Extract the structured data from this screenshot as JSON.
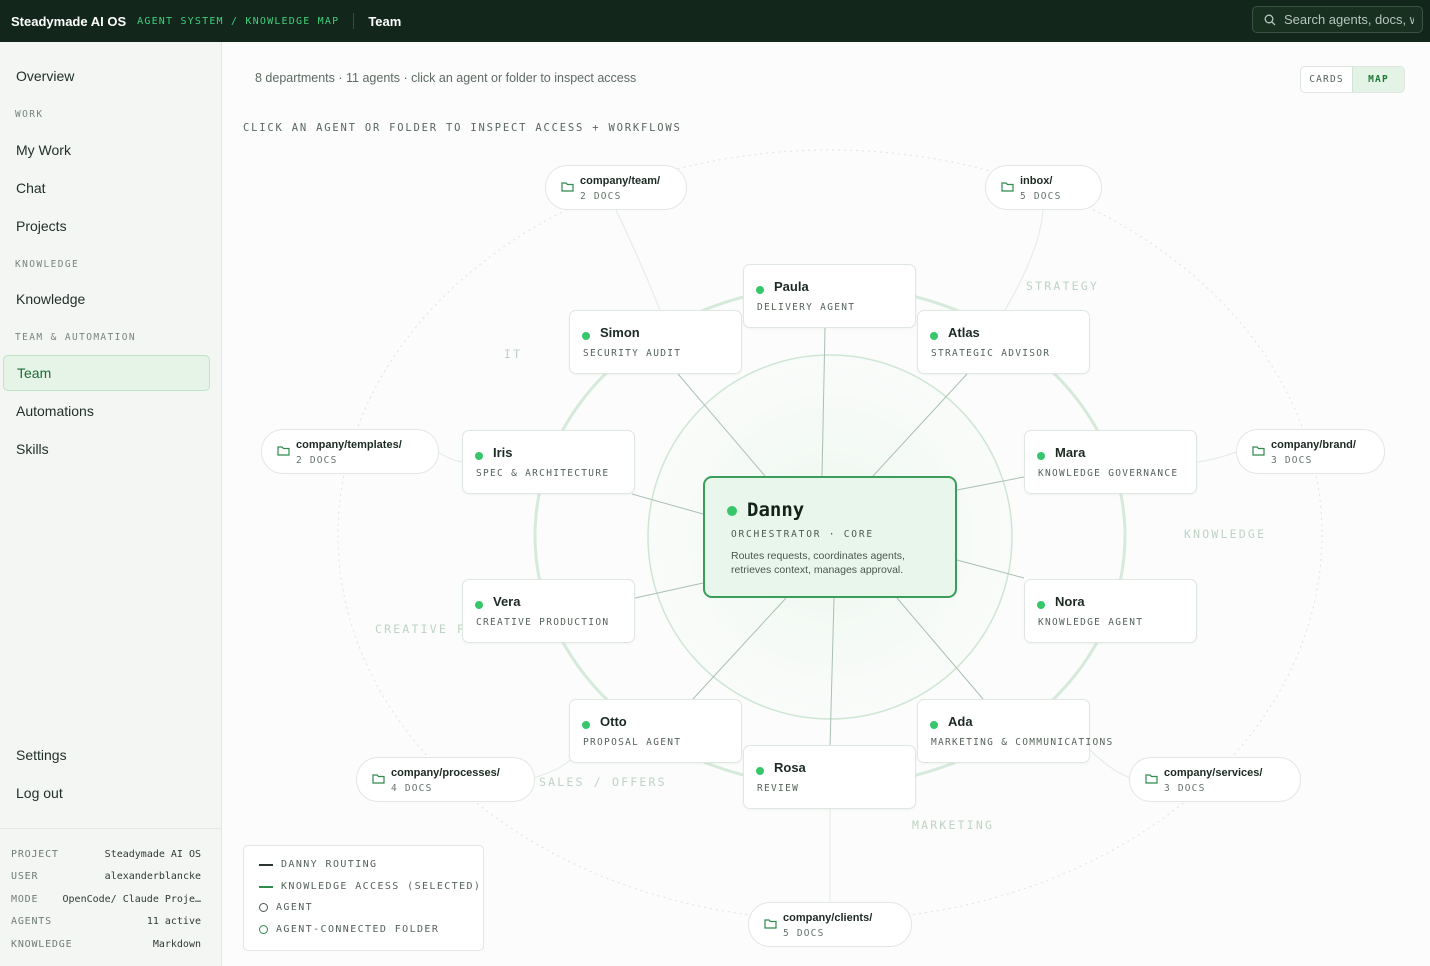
{
  "topbar": {
    "brand": "Steadymade AI OS",
    "breadcrumb": "AGENT SYSTEM / KNOWLEDGE MAP",
    "page_title": "Team",
    "search_placeholder": "Search agents, docs, w"
  },
  "sidebar": {
    "overview": "Overview",
    "section_work": "WORK",
    "my_work": "My Work",
    "chat": "Chat",
    "projects": "Projects",
    "section_knowledge": "KNOWLEDGE",
    "knowledge": "Knowledge",
    "section_team": "TEAM & AUTOMATION",
    "team": "Team",
    "automations": "Automations",
    "skills": "Skills",
    "settings": "Settings",
    "logout": "Log out",
    "info": [
      {
        "key": "PROJECT",
        "value": "Steadymade AI OS"
      },
      {
        "key": "USER",
        "value": "alexanderblancke"
      },
      {
        "key": "MODE",
        "value": "OpenCode/ Claude Proje…"
      },
      {
        "key": "AGENTS",
        "value": "11 active"
      },
      {
        "key": "KNOWLEDGE",
        "value": "Markdown"
      }
    ]
  },
  "main": {
    "summary": "8 departments · 11 agents · click an agent or folder to inspect access",
    "view_toggle": {
      "cards": "CARDS",
      "map": "MAP",
      "selected": "MAP"
    },
    "hint": "CLICK AN AGENT OR FOLDER TO INSPECT ACCESS + WORKFLOWS"
  },
  "departments": {
    "strategy": "STRATEGY",
    "it": "IT",
    "knowledge": "KNOWLEDGE",
    "creative": "CREATIVE P",
    "sales": "SALES / OFFERS",
    "marketing": "MARKETING"
  },
  "hub": {
    "name": "Danny",
    "role": "ORCHESTRATOR · CORE",
    "description": "Routes requests, coordinates agents, retrieves context, manages approval."
  },
  "agents": {
    "paula": {
      "name": "Paula",
      "role": "DELIVERY AGENT"
    },
    "simon": {
      "name": "Simon",
      "role": "SECURITY AUDIT"
    },
    "atlas": {
      "name": "Atlas",
      "role": "STRATEGIC ADVISOR"
    },
    "iris": {
      "name": "Iris",
      "role": "SPEC & ARCHITECTURE"
    },
    "mara": {
      "name": "Mara",
      "role": "KNOWLEDGE GOVERNANCE"
    },
    "vera": {
      "name": "Vera",
      "role": "CREATIVE PRODUCTION"
    },
    "nora": {
      "name": "Nora",
      "role": "KNOWLEDGE AGENT"
    },
    "otto": {
      "name": "Otto",
      "role": "PROPOSAL AGENT"
    },
    "ada": {
      "name": "Ada",
      "role": "MARKETING & COMMUNICATIONS"
    },
    "rosa": {
      "name": "Rosa",
      "role": "REVIEW"
    }
  },
  "folders": {
    "team": {
      "name": "company/team/",
      "docs": "2 DOCS"
    },
    "inbox": {
      "name": "inbox/",
      "docs": "5 DOCS"
    },
    "templates": {
      "name": "company/templates/",
      "docs": "2 DOCS"
    },
    "brand": {
      "name": "company/brand/",
      "docs": "3 DOCS"
    },
    "processes": {
      "name": "company/processes/",
      "docs": "4 DOCS"
    },
    "services": {
      "name": "company/services/",
      "docs": "3 DOCS"
    },
    "clients": {
      "name": "company/clients/",
      "docs": "5 DOCS"
    }
  },
  "legend": {
    "routing": "DANNY ROUTING",
    "access": "KNOWLEDGE ACCESS (SELECTED)",
    "agent": "AGENT",
    "folder": "AGENT-CONNECTED FOLDER"
  },
  "colors": {
    "topbar_bg": "#12261c",
    "accent": "#3ed07a",
    "active_dot": "#36c76a",
    "hub_border": "#3a9e5a",
    "routing_line": "#2a3530",
    "access_line": "#2f8a4c"
  }
}
